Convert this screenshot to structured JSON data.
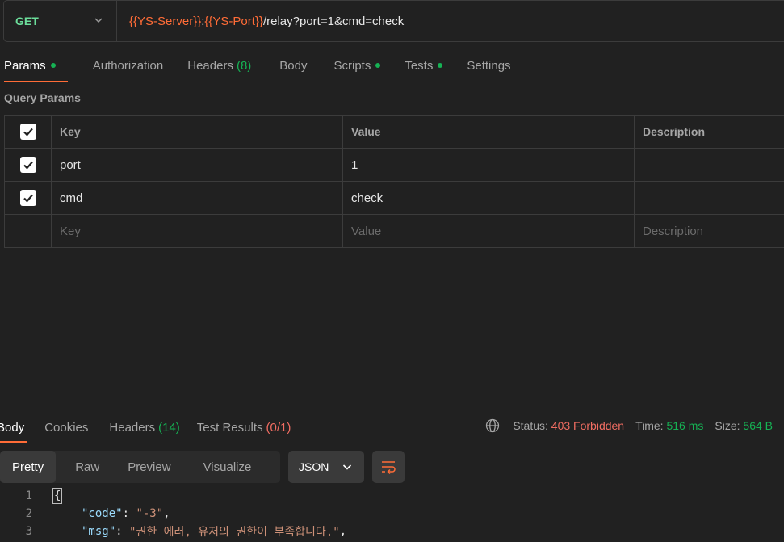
{
  "request": {
    "method": "GET",
    "url": {
      "server_var": "{{YS-Server}}",
      "colon": ":",
      "port_var": "{{YS-Port}}",
      "path": "/relay?port=1&cmd=check"
    }
  },
  "request_tabs": [
    {
      "label": "Params",
      "dot": true,
      "active": true
    },
    {
      "label": "Authorization"
    },
    {
      "label": "Headers",
      "count": "(8)"
    },
    {
      "label": "Body"
    },
    {
      "label": "Scripts",
      "dot": true
    },
    {
      "label": "Tests",
      "dot": true
    },
    {
      "label": "Settings"
    }
  ],
  "query_params": {
    "title": "Query Params",
    "headers": {
      "key": "Key",
      "value": "Value",
      "description": "Description"
    },
    "rows": [
      {
        "checked": true,
        "key": "port",
        "value": "1",
        "description": ""
      },
      {
        "checked": true,
        "key": "cmd",
        "value": "check",
        "description": ""
      }
    ],
    "placeholders": {
      "key": "Key",
      "value": "Value",
      "description": "Description"
    }
  },
  "response_tabs": [
    {
      "label": "Body",
      "active": true
    },
    {
      "label": "Cookies"
    },
    {
      "label": "Headers",
      "count": "(14)"
    },
    {
      "label": "Test Results",
      "count": "(0/1)"
    }
  ],
  "response_meta": {
    "status_label": "Status:",
    "status_value": "403 Forbidden",
    "time_label": "Time:",
    "time_value": "516 ms",
    "size_label": "Size:",
    "size_value": "564 B"
  },
  "format_tabs": [
    "Pretty",
    "Raw",
    "Preview",
    "Visualize"
  ],
  "format_active": "Pretty",
  "language": "JSON",
  "code_lines": [
    {
      "n": "1",
      "open": "{"
    },
    {
      "n": "2",
      "key": "\"code\"",
      "sep": ": ",
      "val": "\"-3\"",
      "end": ","
    },
    {
      "n": "3",
      "key": "\"msg\"",
      "sep": ": ",
      "val": "\"권한 에러, 유저의 권한이 부족합니다.\"",
      "end": ","
    }
  ],
  "colors": {
    "accent": "#ff6c37",
    "method_get": "#6bdd9a",
    "green": "#16b254",
    "error": "#f16d62"
  },
  "icons": [
    "chevron-down-icon",
    "checkbox-checked-icon",
    "globe-icon",
    "wrap-lines-icon"
  ]
}
